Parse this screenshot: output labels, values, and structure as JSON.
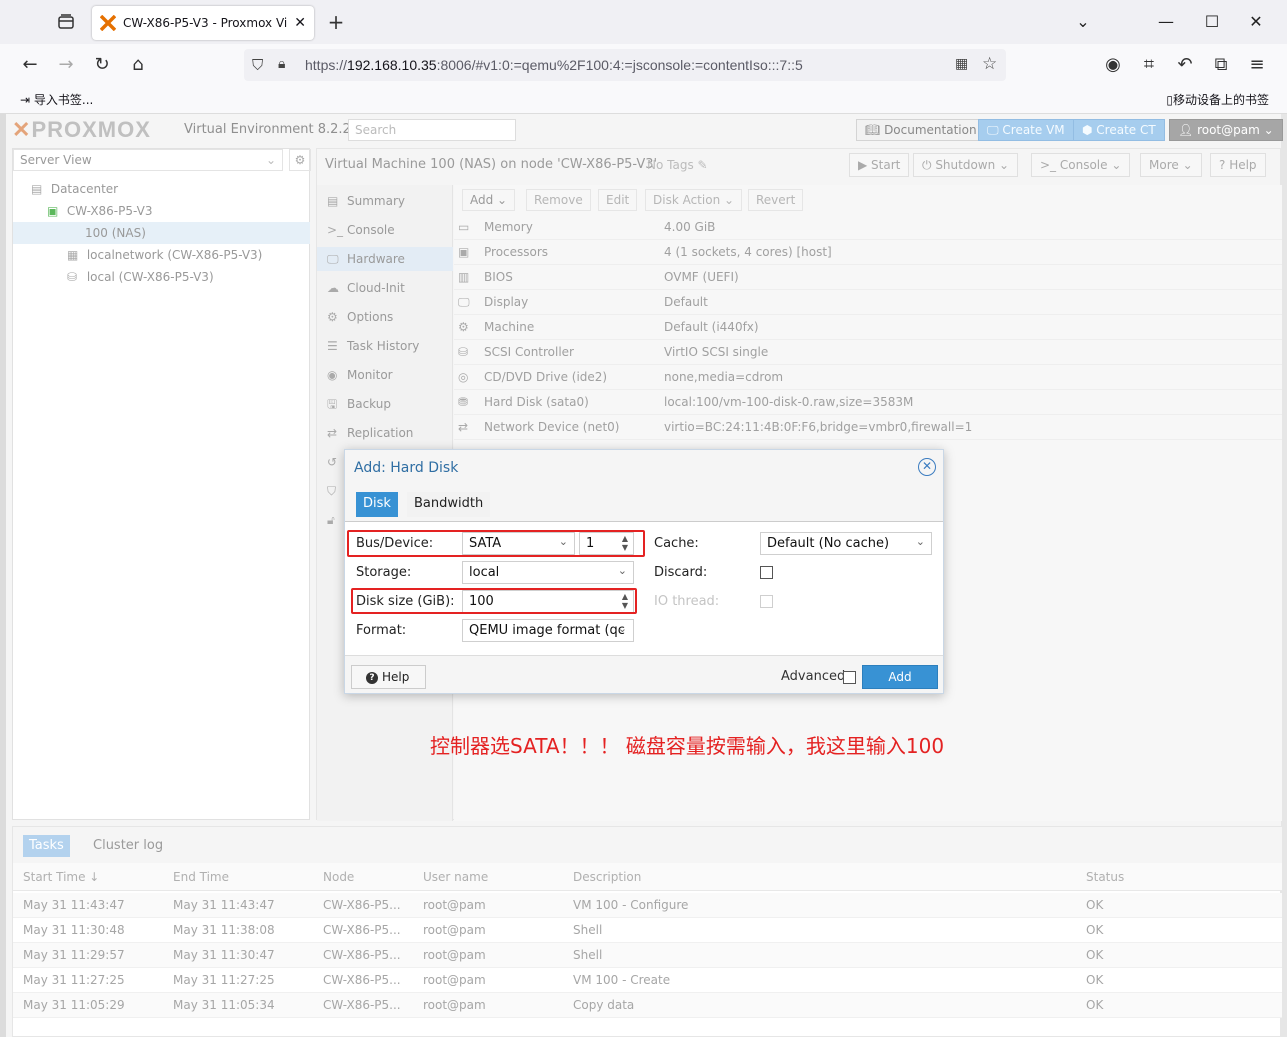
{
  "browser": {
    "tab_title": "CW-X86-P5-V3 - Proxmox Vi",
    "url_prefix": "https://",
    "url_host": "192.168.10.35",
    "url_rest": ":8006/#v1:0:=qemu%2F100:4:=jsconsole:=contentIso:::7::5",
    "bookmark_import": "导入书签...",
    "bookmark_mobile": "移动设备上的书签"
  },
  "header": {
    "logo": "PROXMOX",
    "version": "Virtual Environment 8.2.2",
    "search_placeholder": "Search",
    "documentation": "Documentation",
    "create_vm": "Create VM",
    "create_ct": "Create CT",
    "user": "root@pam"
  },
  "tree": {
    "view": "Server View",
    "nodes": [
      "Datacenter",
      "CW-X86-P5-V3",
      "100 (NAS)",
      "localnetwork (CW-X86-P5-V3)",
      "local (CW-X86-P5-V3)"
    ]
  },
  "vm": {
    "title": "Virtual Machine 100 (NAS) on node 'CW-X86-P5-V3'",
    "no_tags": "No Tags",
    "start": "Start",
    "shutdown": "Shutdown",
    "console": "Console",
    "more": "More",
    "help": "Help"
  },
  "vmnav": [
    "Summary",
    "Console",
    "Hardware",
    "Cloud-Init",
    "Options",
    "Task History",
    "Monitor",
    "Backup",
    "Replication"
  ],
  "hw_toolbar": [
    "Add",
    "Remove",
    "Edit",
    "Disk Action",
    "Revert"
  ],
  "hardware": [
    {
      "k": "Memory",
      "v": "4.00 GiB",
      "icon": "memory-icon"
    },
    {
      "k": "Processors",
      "v": "4 (1 sockets, 4 cores) [host]",
      "icon": "cpu-icon"
    },
    {
      "k": "BIOS",
      "v": "OVMF (UEFI)",
      "icon": "bios-icon"
    },
    {
      "k": "Display",
      "v": "Default",
      "icon": "display-icon"
    },
    {
      "k": "Machine",
      "v": "Default (i440fx)",
      "icon": "machine-icon"
    },
    {
      "k": "SCSI Controller",
      "v": "VirtIO SCSI single",
      "icon": "database-icon"
    },
    {
      "k": "CD/DVD Drive (ide2)",
      "v": "none,media=cdrom",
      "icon": "cdrom-icon"
    },
    {
      "k": "Hard Disk (sata0)",
      "v": "local:100/vm-100-disk-0.raw,size=3583M",
      "icon": "harddisk-icon"
    },
    {
      "k": "Network Device (net0)",
      "v": "virtio=BC:24:11:4B:0F:F6,bridge=vmbr0,firewall=1",
      "icon": "network-icon"
    }
  ],
  "dialog": {
    "title": "Add: Hard Disk",
    "tab_disk": "Disk",
    "tab_bandwidth": "Bandwidth",
    "bus_label": "Bus/Device:",
    "bus_value": "SATA",
    "device_value": "1",
    "storage_label": "Storage:",
    "storage_value": "local",
    "size_label": "Disk size (GiB):",
    "size_value": "100",
    "format_label": "Format:",
    "format_value": "QEMU image format (qc",
    "cache_label": "Cache:",
    "cache_value": "Default (No cache)",
    "discard_label": "Discard:",
    "iothread_label": "IO thread:",
    "help": "Help",
    "advanced": "Advanced",
    "add": "Add"
  },
  "annotation": "控制器选SATA！！！ 磁盘容量按需输入，我这里输入100",
  "tasks": {
    "tab_tasks": "Tasks",
    "tab_cluster": "Cluster log",
    "columns": [
      "Start Time ↓",
      "End Time",
      "Node",
      "User name",
      "Description",
      "Status"
    ],
    "rows": [
      [
        "May 31 11:43:47",
        "May 31 11:43:47",
        "CW-X86-P5...",
        "root@pam",
        "VM 100 - Configure",
        "OK"
      ],
      [
        "May 31 11:30:48",
        "May 31 11:38:08",
        "CW-X86-P5...",
        "root@pam",
        "Shell",
        "OK"
      ],
      [
        "May 31 11:29:57",
        "May 31 11:30:47",
        "CW-X86-P5...",
        "root@pam",
        "Shell",
        "OK"
      ],
      [
        "May 31 11:27:25",
        "May 31 11:27:25",
        "CW-X86-P5...",
        "root@pam",
        "VM 100 - Create",
        "OK"
      ],
      [
        "May 31 11:05:29",
        "May 31 11:05:34",
        "CW-X86-P5...",
        "root@pam",
        "Copy data",
        "OK"
      ]
    ]
  }
}
